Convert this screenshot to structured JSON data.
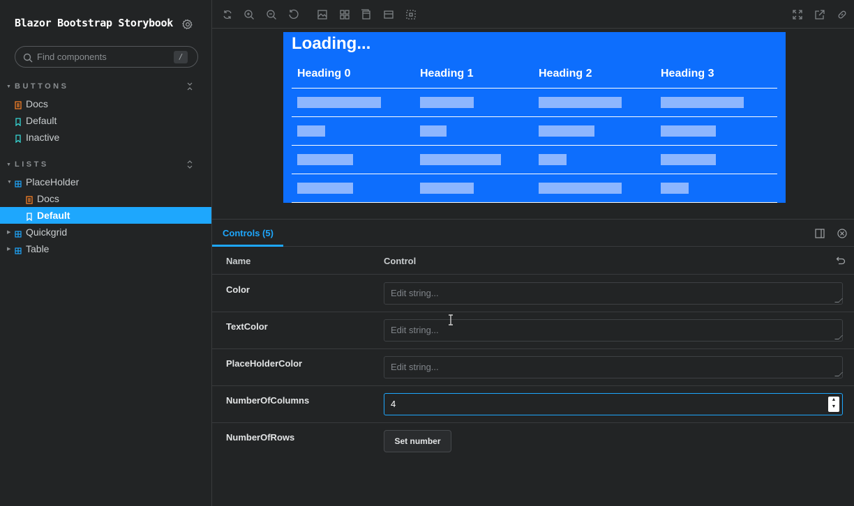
{
  "sidebar": {
    "brand": "Blazor Bootstrap Storybook",
    "search_placeholder": "Find components",
    "search_shortcut": "/",
    "groups": [
      {
        "label": "BUTTONS",
        "items": [
          "Docs",
          "Default",
          "Inactive"
        ]
      },
      {
        "label": "LISTS",
        "items": [
          "PlaceHolder",
          "Docs",
          "Default",
          "Quickgrid",
          "Table"
        ]
      }
    ]
  },
  "preview": {
    "loading": "Loading...",
    "headings": [
      "Heading 0",
      "Heading 1",
      "Heading 2",
      "Heading 3"
    ],
    "rows": 4
  },
  "panel": {
    "tab": "Controls (5)",
    "head_name": "Name",
    "head_control": "Control",
    "rows": [
      {
        "name": "Color",
        "placeholder": "Edit string..."
      },
      {
        "name": "TextColor",
        "placeholder": "Edit string..."
      },
      {
        "name": "PlaceHolderColor",
        "placeholder": "Edit string..."
      },
      {
        "name": "NumberOfColumns",
        "value": "4"
      },
      {
        "name": "NumberOfRows",
        "button": "Set number"
      }
    ]
  },
  "colors": {
    "accent": "#1ea7fd",
    "canvas": "#0d6efd",
    "placeholder": "#8db6fe"
  }
}
